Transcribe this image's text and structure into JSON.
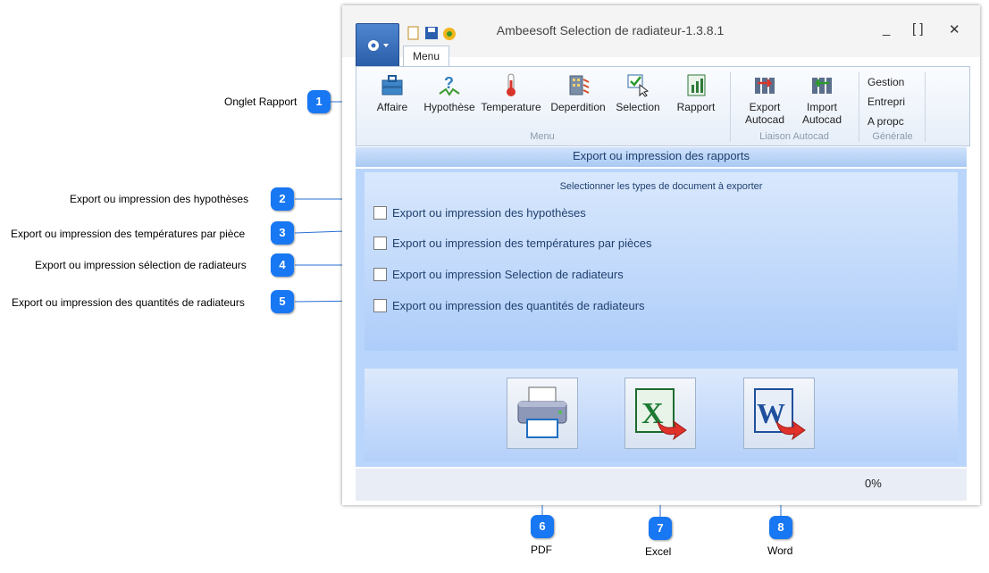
{
  "window": {
    "title": "Ambeesoft Selection de radiateur-1.3.8.1",
    "minimize": "_",
    "maximize": "[ ]",
    "close": "✕",
    "tab": "Menu"
  },
  "ribbon": {
    "items": [
      {
        "label": "Affaire",
        "icon": "briefcase-icon"
      },
      {
        "label": "Hypothèse",
        "icon": "question-icon"
      },
      {
        "label": "Temperature",
        "icon": "thermometer-icon"
      },
      {
        "label": "Deperdition",
        "icon": "building-icon"
      },
      {
        "label": "Selection",
        "icon": "select-check-icon"
      },
      {
        "label": "Rapport",
        "icon": "report-icon"
      }
    ],
    "autocad_items": [
      {
        "line1": "Export",
        "line2": "Autocad",
        "icon": "export-autocad-icon"
      },
      {
        "line1": "Import",
        "line2": "Autocad",
        "icon": "import-autocad-icon"
      }
    ],
    "general_items": [
      "Gestion",
      "Entrepri",
      "A propc"
    ],
    "groups": {
      "menu": "Menu",
      "autocad": "Liaison Autocad",
      "general": "Générale"
    }
  },
  "panel": {
    "banner": "Export ou impression des rapports",
    "options_title": "Selectionner les types de document à exporter",
    "options": [
      {
        "label": "Export ou impression des hypothèses",
        "checked": false
      },
      {
        "label": "Export ou impression des températures par pièces",
        "checked": false
      },
      {
        "label": "Export ou impression Selection de radiateurs",
        "checked": false
      },
      {
        "label": "Export ou impression des quantités de radiateurs",
        "checked": false
      }
    ],
    "progress": "0%"
  },
  "callouts": [
    {
      "number": "1",
      "label": "Onglet Rapport"
    },
    {
      "number": "2",
      "label": "Export ou impression des hypothèses"
    },
    {
      "number": "3",
      "label": "Export ou impression des températures par pièce"
    },
    {
      "number": "4",
      "label": "Export ou impression sélection de radiateurs"
    },
    {
      "number": "5",
      "label": "Export ou impression des quantités de radiateurs"
    },
    {
      "number": "6",
      "label": "PDF"
    },
    {
      "number": "7",
      "label": "Excel"
    },
    {
      "number": "8",
      "label": "Word"
    }
  ],
  "colors": {
    "accent": "#1877f2",
    "panel": "#b9d5fb",
    "text": "#1f3f6e"
  }
}
